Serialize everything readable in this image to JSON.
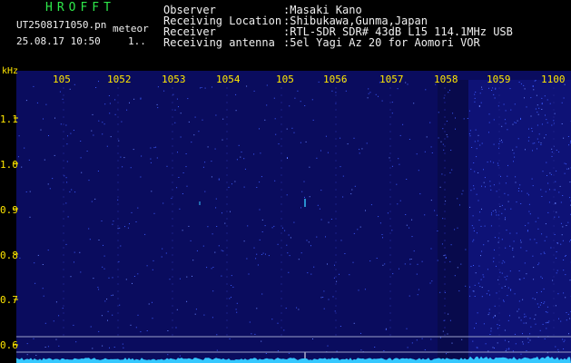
{
  "header": {
    "brand": "HROFFT",
    "file_name": "UT2508171050.pn",
    "tag": "meteor",
    "datetime": "25.08.17 10:50",
    "extra": "1.."
  },
  "info": [
    {
      "label": "Observer",
      "value": ":Masaki Kano"
    },
    {
      "label": "Receiving Location",
      "value": ":Shibukawa,Gunma,Japan"
    },
    {
      "label": "Receiver",
      "value": ":RTL-SDR SDR# 43dB L15 114.1MHz USB"
    },
    {
      "label": "Receiving antenna",
      "value": ":5el Yagi Az 20 for Aomori VOR"
    }
  ],
  "axis": {
    "unit": "kHz",
    "y_ticks": [
      "1.1",
      "1.0",
      "0.9",
      "0.8",
      "0.7",
      "0.6"
    ],
    "x_ticks": [
      "105",
      "1052",
      "1053",
      "1054",
      "105",
      "1056",
      "1057",
      "1058",
      "1059",
      "1100"
    ]
  },
  "colors": {
    "background": "#000000",
    "plot_bg": "#0a0c5e",
    "text_green": "#2ee84a",
    "text_white": "#f0f0f0",
    "text_yellow": "#ffe700",
    "noise": "#3e5cff",
    "trace": "#35c8ff"
  }
}
